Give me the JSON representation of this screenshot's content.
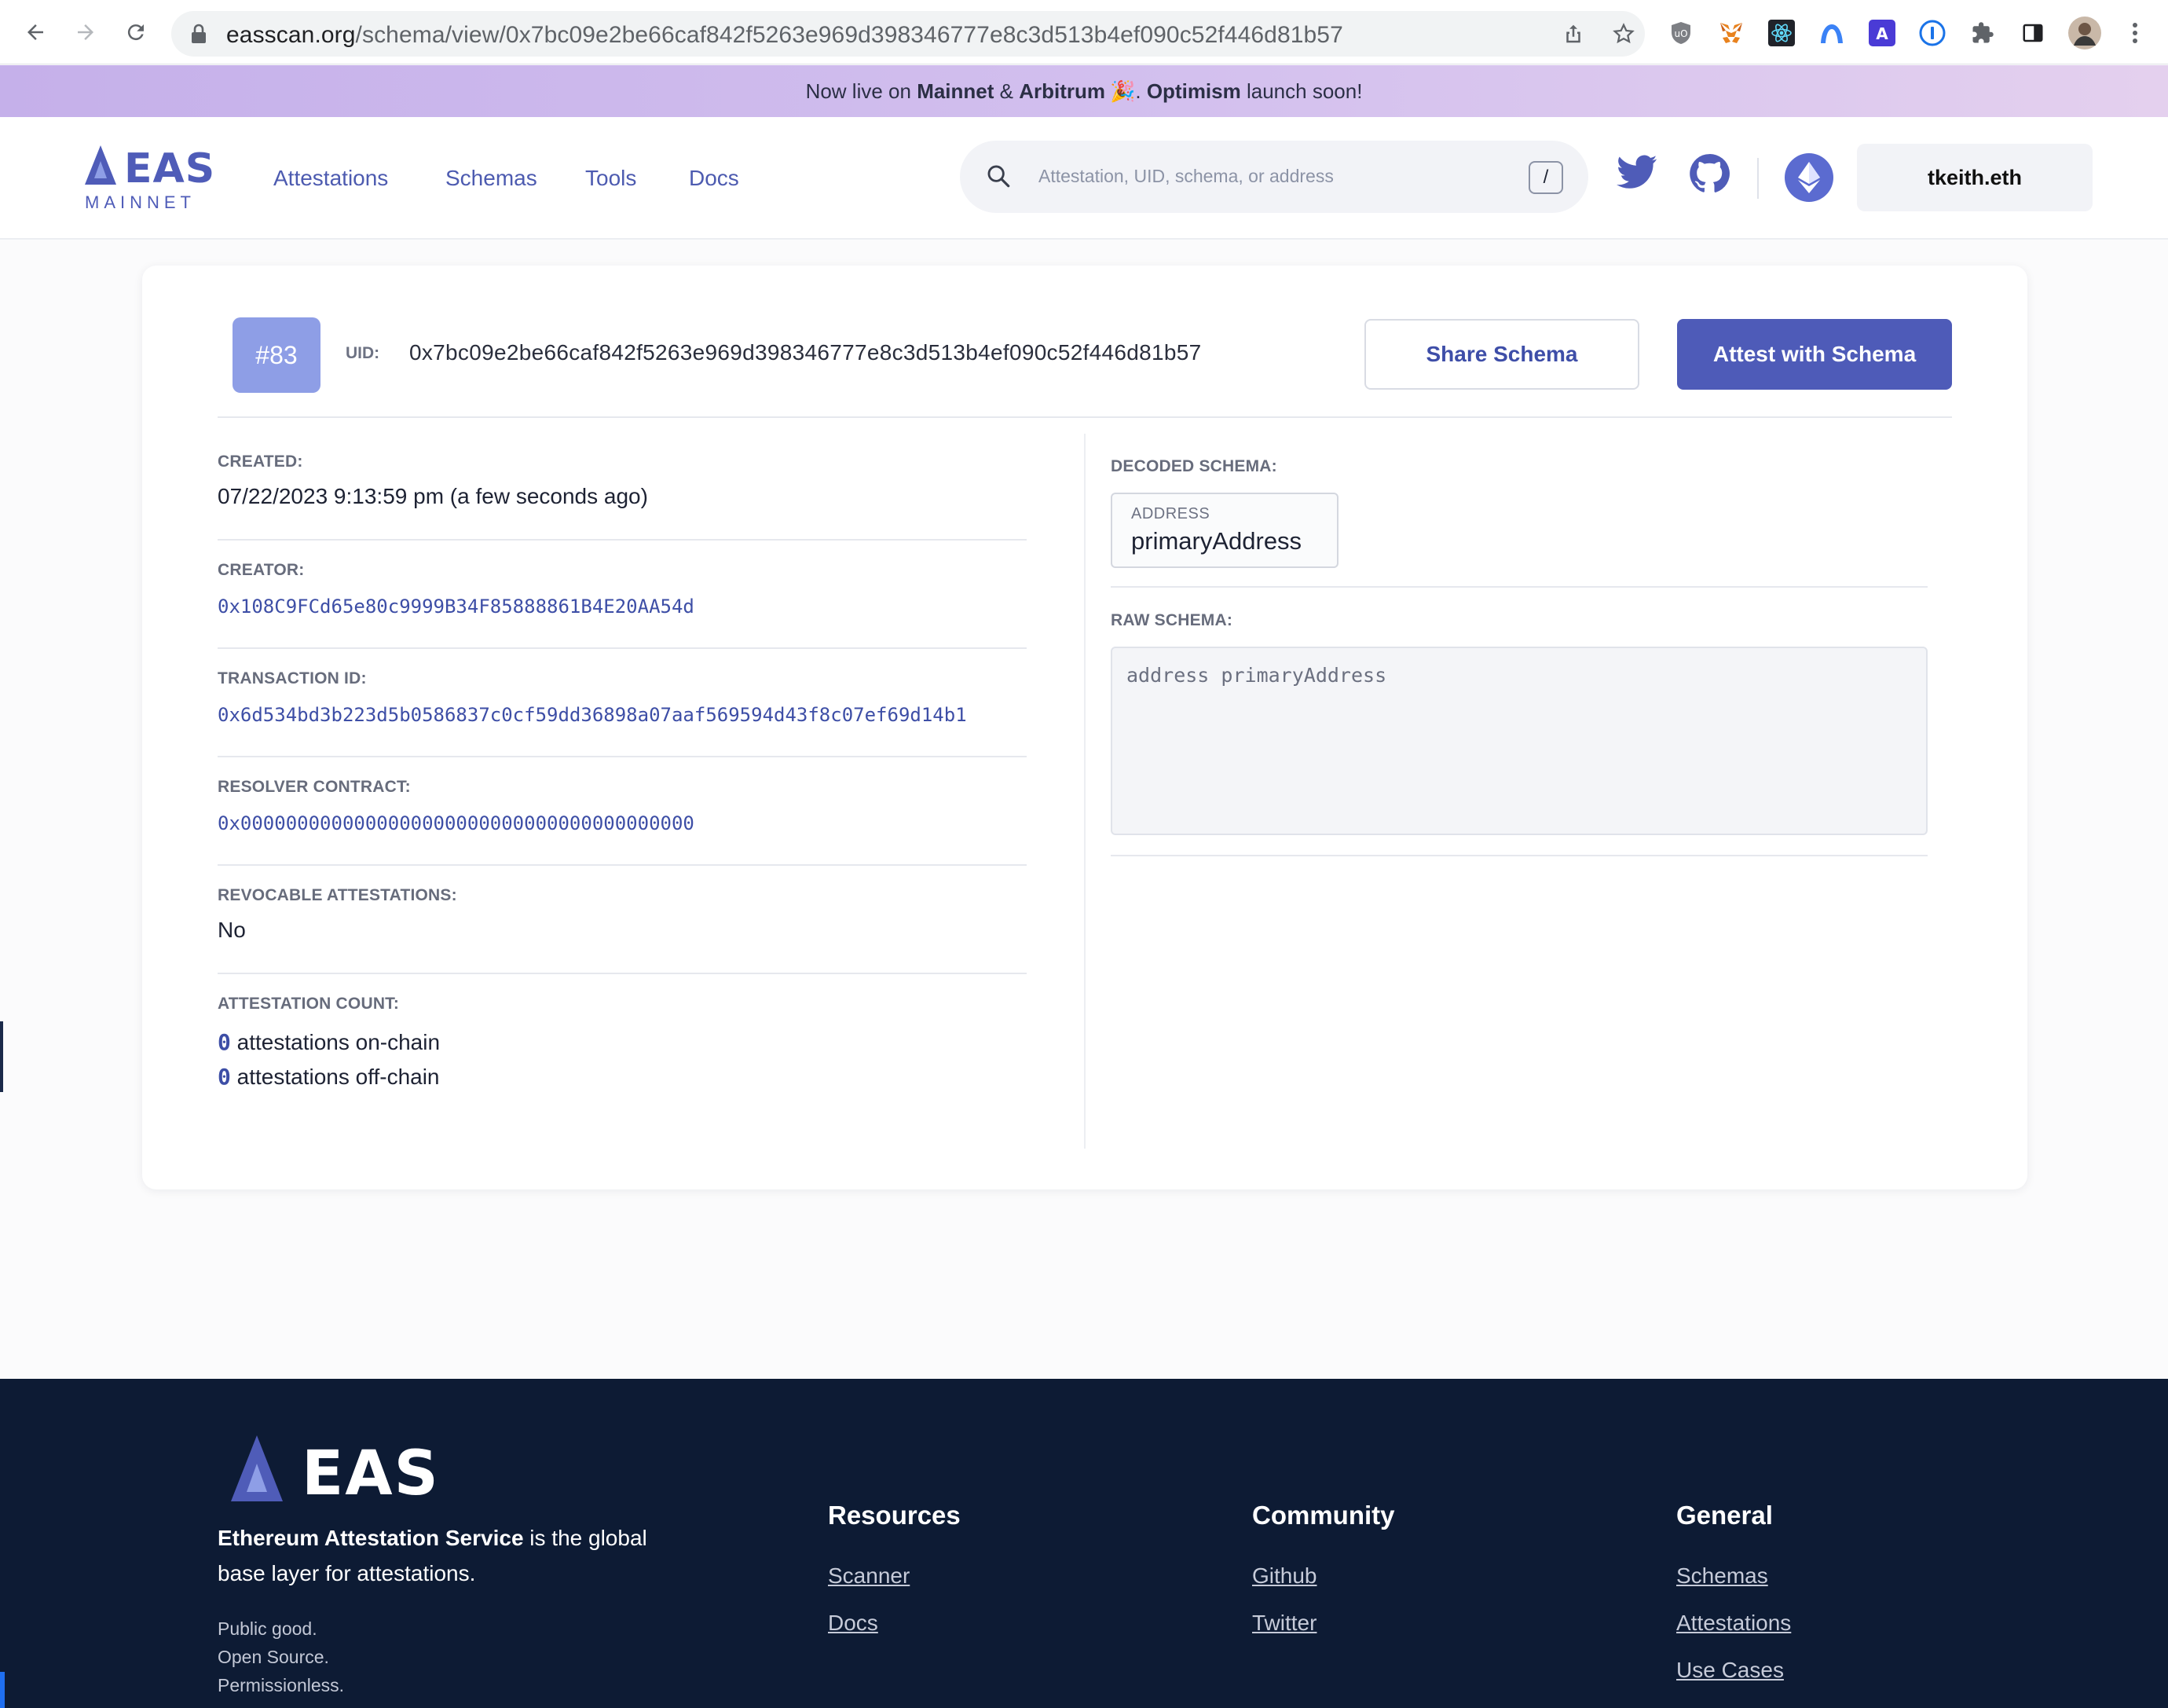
{
  "browser": {
    "url_host": "easscan.org",
    "url_path": "/schema/view/0x7bc09e2be66caf842f5263e969d398346777e8c3d513b4ef090c52f446d81b57"
  },
  "banner": {
    "prefix": "Now live on ",
    "mainnet": "Mainnet",
    "amp": " & ",
    "arbitrum": "Arbitrum",
    "emoji": "🎉",
    "dot": ". ",
    "optimism": "Optimism",
    "suffix": " launch soon!"
  },
  "header": {
    "logo_text": "EAS",
    "network": "MAINNET",
    "nav": [
      "Attestations",
      "Schemas",
      "Tools",
      "Docs"
    ],
    "search_placeholder": "Attestation, UID, schema, or address",
    "search_shortcut": "/",
    "wallet": "tkeith.eth"
  },
  "schema": {
    "number": "#83",
    "uid_label": "UID:",
    "uid": "0x7bc09e2be66caf842f5263e969d398346777e8c3d513b4ef090c52f446d81b57",
    "share_label": "Share Schema",
    "attest_label": "Attest with Schema",
    "created_label": "CREATED:",
    "created_value": "07/22/2023 9:13:59 pm (a few seconds ago)",
    "creator_label": "CREATOR:",
    "creator_value": "0x108C9FCd65e80c9999B34F85888861B4E20AA54d",
    "tx_label": "TRANSACTION ID:",
    "tx_value": "0x6d534bd3b223d5b0586837c0cf59dd36898a07aaf569594d43f8c07ef69d14b1",
    "resolver_label": "RESOLVER CONTRACT:",
    "resolver_value": "0x0000000000000000000000000000000000000000",
    "revocable_label": "REVOCABLE ATTESTATIONS:",
    "revocable_value": "No",
    "count_label": "ATTESTATION COUNT:",
    "onchain_count": "0",
    "onchain_text": " attestations on-chain",
    "offchain_count": "0",
    "offchain_text": " attestations off-chain",
    "decoded_label": "DECODED SCHEMA:",
    "decoded_type": "ADDRESS",
    "decoded_name": "primaryAddress",
    "raw_label": "RAW SCHEMA:",
    "raw_value": "address primaryAddress"
  },
  "footer": {
    "logo_text": "EAS",
    "tagline_bold": "Ethereum Attestation Service",
    "tagline_rest": " is the global base layer for attestations.",
    "sub": [
      "Public good.",
      "Open Source.",
      "Permissionless."
    ],
    "resources_title": "Resources",
    "resources": [
      "Scanner",
      "Docs"
    ],
    "community_title": "Community",
    "community": [
      "Github",
      "Twitter"
    ],
    "general_title": "General",
    "general": [
      "Schemas",
      "Attestations",
      "Use Cases"
    ]
  },
  "colors": {
    "brand": "#4e5bb8",
    "badge": "#8e9ee6",
    "footer_bg": "#0d1b34",
    "banner_start": "#c5b0ea",
    "banner_end": "#e4d0ee"
  }
}
